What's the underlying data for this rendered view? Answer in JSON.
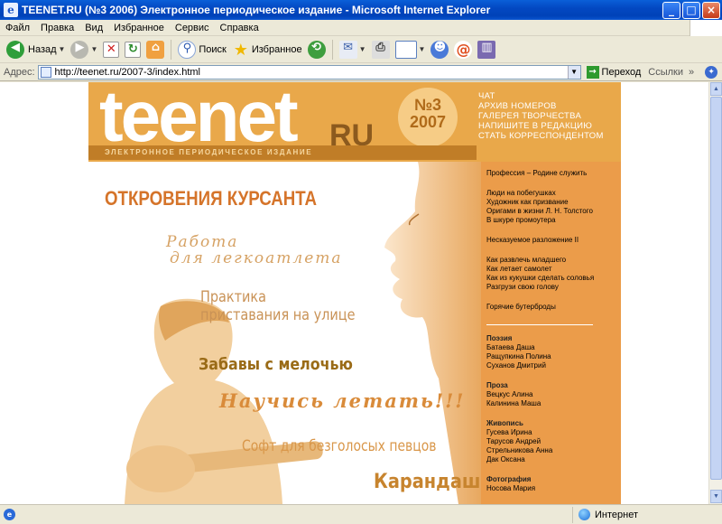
{
  "window": {
    "title": "TEENET.RU (№3 2006) Электронное периодическое издание - Microsoft Internet Explorer"
  },
  "menu": [
    "Файл",
    "Правка",
    "Вид",
    "Избранное",
    "Сервис",
    "Справка"
  ],
  "toolbar": {
    "back": "Назад",
    "search": "Поиск",
    "favorites": "Избранное"
  },
  "address": {
    "label": "Адрес:",
    "url": "http://teenet.ru/2007-3/index.html",
    "go": "Переход",
    "links": "Ссылки"
  },
  "status": {
    "zone": "Интернет"
  },
  "site": {
    "logo": "teenet",
    "logo_suffix": "RU",
    "issue_no": "№3",
    "issue_year": "2007",
    "tagline": "Электронное периодическое издание",
    "topnav": [
      "Чат",
      "Архив номеров",
      "Галерея творчества",
      "Напишите в редакцию",
      "Стать корреспондентом"
    ],
    "articles": [
      "ОТКРОВЕНИЯ КУРСАНТА",
      "Работа",
      "для легкоатлета",
      "Практика",
      "приставания на улице",
      "Забавы с мелочью",
      "Научись летать!!!",
      "Софт для безголосых певцов",
      "Карандаш"
    ],
    "sidebar": {
      "group1": [
        "Профессия – Родине служить"
      ],
      "group2": [
        "Люди на побегушках",
        "Художник как призвание",
        "Оригами в жизни Л. Н. Толстого",
        "В шкуре промоутера"
      ],
      "group3": [
        "Несказуемое разложение II"
      ],
      "group4": [
        "Как развлечь младшего",
        "Как летает самолет",
        "Как из кукушки сделать соловья",
        "Разгрузи свою голову"
      ],
      "group5": [
        "Горячие бутерброды"
      ],
      "sections": [
        {
          "title": "Поэзия",
          "items": [
            "Батаева Даша",
            "Ращупкина Полина",
            "Суханов Дмитрий"
          ]
        },
        {
          "title": "Проза",
          "items": [
            "Вецкус Алина",
            "Калинина Маша"
          ]
        },
        {
          "title": "Живопись",
          "items": [
            "Гусева Ирина",
            "Тарусов Андрей",
            "Стрельникова Анна",
            "Дак Оксана"
          ]
        },
        {
          "title": "Фотография",
          "items": [
            "Носова Мария"
          ]
        }
      ]
    }
  }
}
